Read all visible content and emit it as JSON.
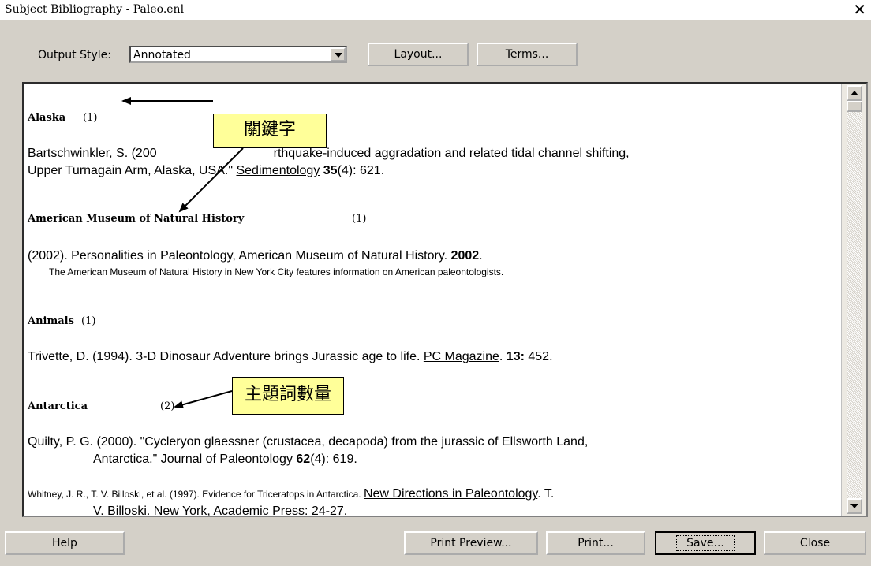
{
  "window": {
    "title": "Subject Bibliography - Paleo.enl",
    "close_glyph": "✕"
  },
  "toolbar": {
    "output_style_label": "Output Style:",
    "output_style_value": "Annotated",
    "layout_label": "Layout...",
    "terms_label": "Terms..."
  },
  "entries": [
    {
      "keyword": "Alaska",
      "count": "(1)"
    },
    {
      "keyword": "American Museum of Natural History",
      "count": "(1)"
    },
    {
      "keyword": "Animals",
      "count": "(1)"
    },
    {
      "keyword": "Antarctica",
      "count": "(2)"
    }
  ],
  "refs": {
    "r1_line1_a": "Bartschwinkler, S. (200",
    "r1_line1_b": "rthquake-induced aggradation and related tidal channel shifting,",
    "r1_line2_a": "Upper Turnagain Arm, Alaska, USA.\" ",
    "r1_line2_journal": "Sedimentology",
    "r1_line2_vol": " 35",
    "r1_line2_end": "(4): 621.",
    "r2_a": "(2002). Personalities in Paleontology, American Museum of Natural History. ",
    "r2_year": "2002",
    "r2_end": ".",
    "r2_note": "The American Museum of Natural History in New York City features information on American paleontologists.",
    "r3_a": "Trivette, D. (1994). 3-D Dinosaur Adventure brings Jurassic age to life. ",
    "r3_journal": "PC Magazine",
    "r3_sep": ". ",
    "r3_vol": "13:",
    "r3_end": " 452.",
    "r4_line1": "Quilty, P. G. (2000). \"Cycleryon glaessner (crustacea, decapoda) from the jurassic of Ellsworth Land,",
    "r4_line2_a": "Antarctica.\" ",
    "r4_line2_journal": "Journal of Paleontology",
    "r4_line2_vol": " 62",
    "r4_line2_end": "(4): 619.",
    "r5_line1_a": "Whitney, J. R., T. V. Billoski, et al. (1997). Evidence for Triceratops in Antarctica. ",
    "r5_line1_journal": "New Directions in Paleontology",
    "r5_line1_end": ". T.",
    "r5_line2": "V. Billoski. New York, Academic Press: 24-27."
  },
  "callouts": {
    "keyword": "關鍵字",
    "subject_count": "主題詞數量"
  },
  "buttons": {
    "help": "Help",
    "print_preview": "Print Preview...",
    "print": "Print...",
    "save": "Save...",
    "close": "Close"
  },
  "colors": {
    "callout_bg": "#ffff99",
    "dialog_bg": "#d4d0c8"
  }
}
